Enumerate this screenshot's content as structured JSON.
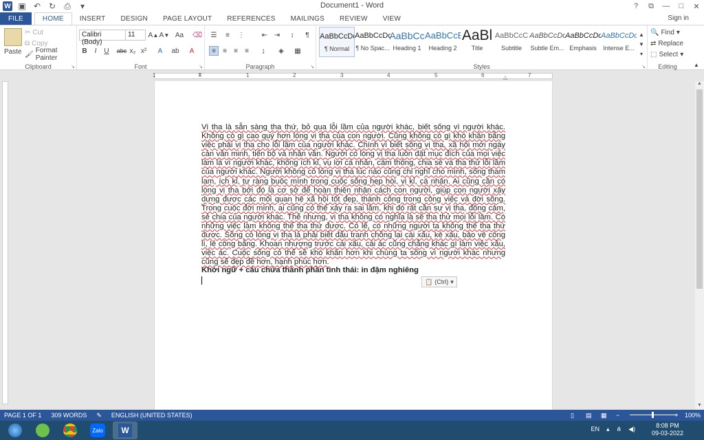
{
  "window": {
    "title": "Document1 - Word",
    "help_icon": "?",
    "restore_icon": "□"
  },
  "tabs": [
    "FILE",
    "HOME",
    "INSERT",
    "DESIGN",
    "PAGE LAYOUT",
    "REFERENCES",
    "MAILINGS",
    "REVIEW",
    "VIEW"
  ],
  "signin": "Sign in",
  "ribbon": {
    "clipboard": {
      "label": "Clipboard",
      "paste": "Paste",
      "cut": "Cut",
      "copy": "Copy",
      "format_painter": "Format Painter"
    },
    "font": {
      "label": "Font",
      "family": "Calibri (Body)",
      "size": "11"
    },
    "paragraph": {
      "label": "Paragraph"
    },
    "styles": {
      "label": "Styles",
      "items": [
        {
          "preview": "AaBbCcDc",
          "name": "¶ Normal"
        },
        {
          "preview": "AaBbCcDc",
          "name": "¶ No Spac..."
        },
        {
          "preview": "AaBbCc",
          "name": "Heading 1"
        },
        {
          "preview": "AaBbCcE",
          "name": "Heading 2"
        },
        {
          "preview": "AaBl",
          "name": "Title"
        },
        {
          "preview": "AaBbCcC",
          "name": "Subtitle"
        },
        {
          "preview": "AaBbCcDc",
          "name": "Subtle Em..."
        },
        {
          "preview": "AaBbCcDc",
          "name": "Emphasis"
        },
        {
          "preview": "AaBbCcDc",
          "name": "Intense E..."
        }
      ]
    },
    "editing": {
      "label": "Editing",
      "find": "Find",
      "replace": "Replace",
      "select": "Select"
    }
  },
  "ruler": [
    "1",
    "1",
    "2",
    "3",
    "4",
    "5",
    "6",
    "7"
  ],
  "document": {
    "body": "Vị tha là sẵn sàng tha thứ, bỏ qua lỗi lầm của người khác, biết sống vì người khác. Không có gì cao quý hơn lòng vị tha của con người. Cũng không có gì khó khăn bằng việc phải vị tha cho lỗi lầm của người khác. Chính vì biết sống vị tha, xã hội mới ngày càn văn minh, tiến bộ và nhân văn. Người có lòng vị tha luôn đặt mục đích của mọi việc làm là vì người khác, không ích kỉ, vụ lợi cá nhân, cảm thông, chia sẻ và tha thứ lỗi lầm của người khác. Người không có lòng vị tha lúc nào cũng chỉ nghĩ cho mình, sống tham lam, ích kỉ, tự ràng buộc mình trong cuộc sống hẹp hòi, vị kỉ, cá nhân. Ai cũng cần có lòng vị tha bởi đó là cơ sở để hoàn thiện nhân cách con người, giúp con người xây dựng được các mối quan hệ xã hội tốt đẹp, thành công trong công việc và đời sống. Trong cuộc đời mình, ai cũng có thể xảy ra sai lầm, khi đó rất cần sự vị tha, đồng cảm, sẻ chia của người khác. Thế nhưng, vị tha không có nghĩa là sẽ tha thứ mọi lỗi lầm. Có những việc làm không thể tha thứ được. Có lẽ, có những người ta không thể tha thứ được. Sống có lòng vị tha là phải biết đấu tranh chống lại cái xấu, kẻ xấu, bảo vệ công lí, lẽ công bằng. Khoan nhượng trước cái xấu, cái ác cũng chẳng khác gì làm việc xấu, việc ác. Cuộc sống có thể sẽ khó khăn hơn khi chúng ta sống vì người khác nhưng cũng sẽ đẹp đẽ hơn, hạnh phúc hơn.",
    "heading": "Khởi ngữ + câu chứa thành phần tình thái: in đậm nghiêng",
    "paste_options": "(Ctrl)"
  },
  "status": {
    "page": "PAGE 1 OF 1",
    "words": "309 WORDS",
    "language": "ENGLISH (UNITED STATES)",
    "zoom": "100%",
    "zoom_level": 1.0
  },
  "taskbar": {
    "lang": "EN",
    "time": "8:08 PM",
    "date": "09-03-2022",
    "apps": [
      "start-button",
      "greenshot-icon",
      "chrome-icon",
      "zalo-icon",
      "word-icon"
    ],
    "zalo_label": "Zalo"
  },
  "colors": {
    "accent": "#2b579a",
    "taskbar": "#1f4c6f",
    "spell": "#d33"
  }
}
